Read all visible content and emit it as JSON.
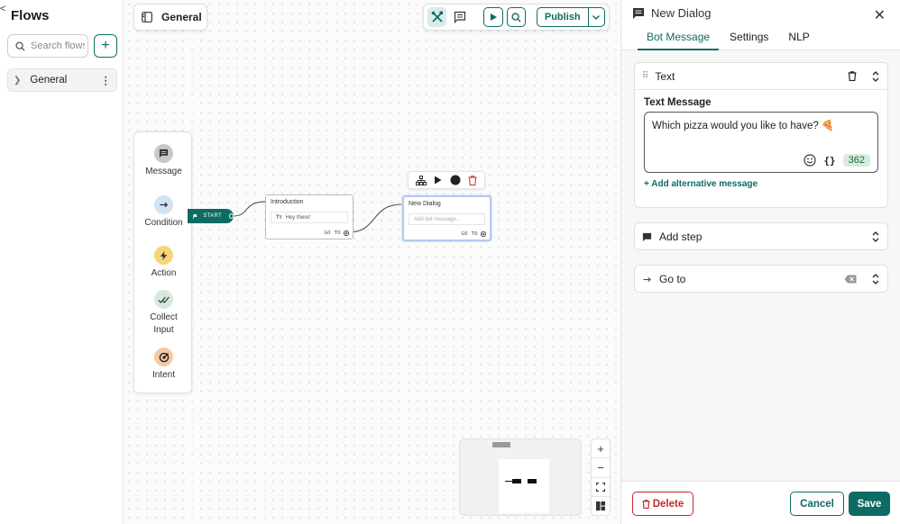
{
  "sidebar": {
    "back_glyph": "<",
    "title": "Flows",
    "search_placeholder": "Search flows",
    "add_glyph": "+",
    "flows": [
      {
        "name": "General"
      }
    ]
  },
  "canvas": {
    "flow_title": "General",
    "publish_label": "Publish",
    "palette": [
      {
        "label": "Message",
        "icon": "message-icon"
      },
      {
        "label": "Condition",
        "icon": "arrow-right-icon"
      },
      {
        "label": "Action",
        "icon": "bolt-icon"
      },
      {
        "label": "Collect Input",
        "icon": "double-check-icon"
      },
      {
        "label": "Intent",
        "icon": "target-icon"
      }
    ],
    "start_label": "START",
    "nodes": {
      "introduction": {
        "title": "Introduction",
        "body": "Hey there!",
        "goto": "GO TO"
      },
      "new_dialog": {
        "title": "New Dialog",
        "placeholder": "Add bot message...",
        "goto": "GO TO"
      }
    },
    "zoom": {
      "in": "+",
      "out": "−"
    }
  },
  "panel": {
    "title": "New Dialog",
    "tabs": [
      "Bot Message",
      "Settings",
      "NLP"
    ],
    "active_tab": 0,
    "text_card": {
      "header": "Text",
      "label": "Text Message",
      "value": "Which pizza would you like to have? 🍕",
      "variables_glyph": "{}",
      "char_count": "362",
      "add_alternative": "+ Add alternative message"
    },
    "add_step": "Add step",
    "go_to": "Go to",
    "buttons": {
      "delete": "Delete",
      "cancel": "Cancel",
      "save": "Save"
    }
  },
  "colors": {
    "accent": "#0d6b63",
    "danger": "#c62828",
    "canvas_bg": "#fbfbfb"
  }
}
